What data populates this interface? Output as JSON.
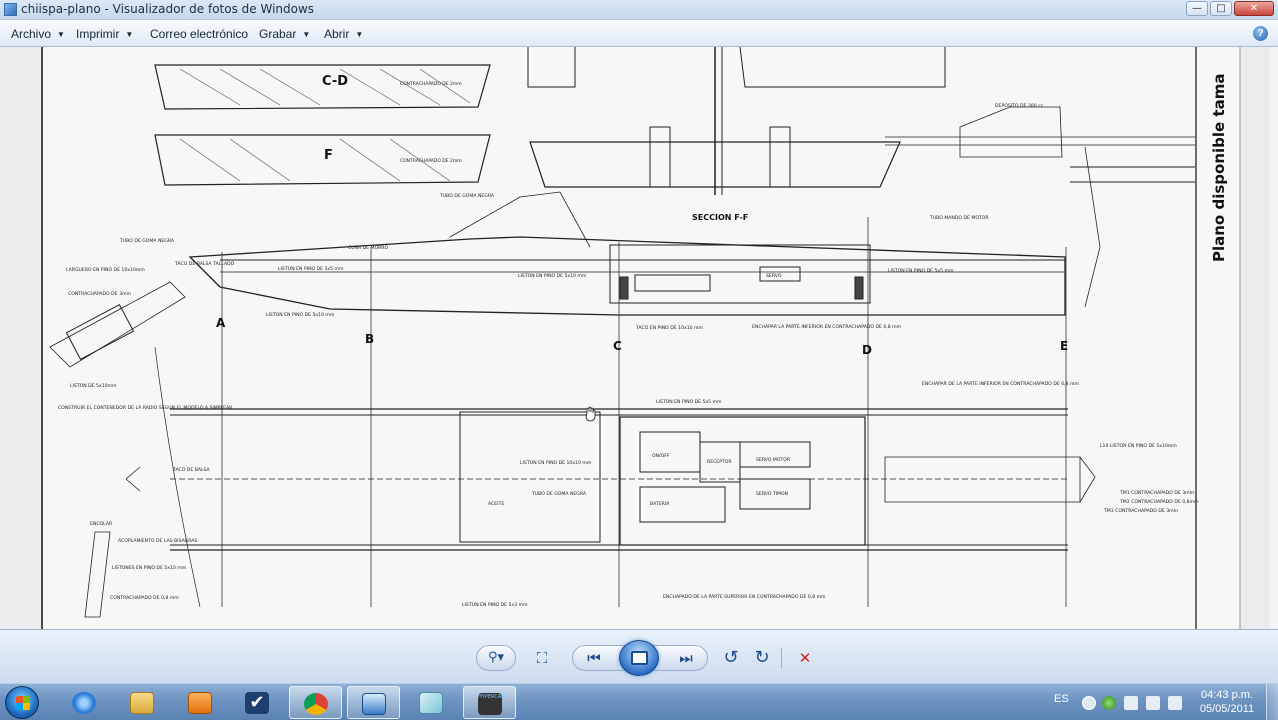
{
  "window": {
    "title": "chiispa-plano - Visualizador de fotos de Windows",
    "controls": {
      "minimize": "—",
      "maximize": "□",
      "close": "✕"
    }
  },
  "menu": {
    "items": [
      {
        "label": "Archivo",
        "has_dropdown": true
      },
      {
        "label": "Imprimir",
        "has_dropdown": true
      },
      {
        "label": "Correo electrónico",
        "has_dropdown": false
      },
      {
        "label": "Grabar",
        "has_dropdown": true
      },
      {
        "label": "Abrir",
        "has_dropdown": true
      }
    ],
    "dropdown_arrow": "▼",
    "help_icon": "?"
  },
  "drawing": {
    "side_title": "Plano disponible tama",
    "section_labels": [
      "C-D",
      "F"
    ],
    "station_labels": [
      "A",
      "B",
      "C",
      "D",
      "E"
    ],
    "section_title": "SECCION F-F",
    "callouts": [
      "CONTRACHAPADO DE 2mm",
      "CONTRACHAPADO DE 2mm",
      "TUBO DE GOMA NEGRA",
      "TUBO DE GOMA NEGRA",
      "LARGUERO EN PINO DE 10x10mm",
      "TACO DE BALSA TALLADO",
      "LISTON EN PINO DE 3x5 mm",
      "LISTON EN PINO DE 5x10 mm",
      "CUÑA DE MORRO",
      "LISTON EN PINO DE 5x10 mm",
      "SERVO",
      "LISTON EN PINO DE 5x5 mm",
      "TUBO MANDO DE MOTOR",
      "DEPOSITO DE 300 cc",
      "TACO EN PINO DE 10x10 mm",
      "ENCHAPAR LA PARTE INFERIOR EN CONTRACHAPADO DE 0,8 mm",
      "CONTRACHAPADO DE 3mm",
      "LISTON DE 5x10mm",
      "CONSTRUIR EL CONTENEDOR DE LA RADIO SEGUN EL MODELO A SIMPLEAR",
      "TACO DE BALSA",
      "LISTON EN PINO DE 5x5 mm",
      "LISTON EN PINO DE 10x10 mm",
      "TUBO DE GOMA NEGRA",
      "ACEITE",
      "RECEPTOR",
      "SERVO MOTOR",
      "SERVO TIMON",
      "BATERIA",
      "ON/OFF",
      "ENCHAPAR DE LA PARTE INFERIOR EN CONTRACHAPADO DE 0,8 mm",
      "ENCHAPADO DE LA PARTE SUPERIOR EN CONTRACHAPADO DE 0,8 mm",
      "LISTON EN PINO DE 5x3 mm",
      "ENCOLAR",
      "ACOPLAMIENTO DE LAS BISAGRAS",
      "LISTONES EN PINO DE 5x10 mm",
      "CONTRACHAPADO DE 0,8 mm",
      "TM1 CONTRACHAPADO DE 3mm",
      "TM2 CONTRACHAPADO DE 0,8mm",
      "TM3 CONTRACHAPADO DE 3mm",
      "L10 LISTON EN PINO DE 5x10mm"
    ]
  },
  "controls": {
    "zoom_icon": "zoom-icon",
    "fit_icon": "fit-window-icon",
    "prev_icon": "previous-icon",
    "slideshow_icon": "slideshow-icon",
    "next_icon": "next-icon",
    "rotate_ccw_icon": "rotate-counterclockwise-icon",
    "rotate_cw_icon": "rotate-clockwise-icon",
    "delete_icon": "delete-icon",
    "symbols": {
      "zoom": "⚲▾",
      "fit": "⛶",
      "prev": "⏮",
      "next": "⏭",
      "rotate_ccw": "↺",
      "rotate_cw": "↻",
      "delete": "✕"
    }
  },
  "taskbar": {
    "apps": [
      {
        "name": "internet-explorer",
        "active": false,
        "color": "#2a7ad6"
      },
      {
        "name": "windows-explorer",
        "active": false,
        "color": "#e8c25a"
      },
      {
        "name": "media-player",
        "active": false,
        "color": "#f08a1e"
      },
      {
        "name": "checkmark-app",
        "active": false,
        "color": "#ffffff"
      },
      {
        "name": "google-chrome",
        "active": true,
        "color": "#db4437"
      },
      {
        "name": "photo-viewer",
        "active": true,
        "color": "#3b7dc6"
      },
      {
        "name": "notes-app",
        "active": false,
        "color": "#9ad3e6"
      },
      {
        "name": "hypercam",
        "active": true,
        "color": "#333333"
      }
    ],
    "hypercam_label": "HYPERCAM",
    "language": "ES",
    "time": "04:43 p.m.",
    "date": "05/05/2011"
  }
}
